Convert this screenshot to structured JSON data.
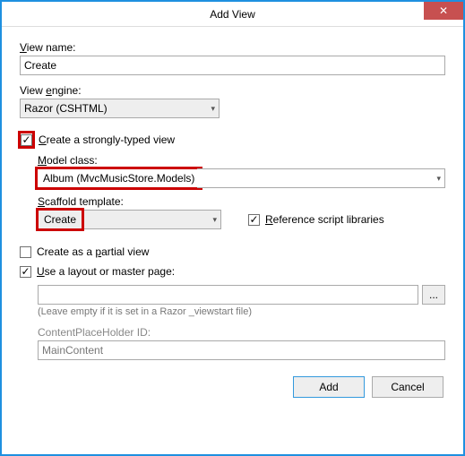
{
  "window": {
    "title": "Add View"
  },
  "viewName": {
    "label": "View name:",
    "value": "Create"
  },
  "viewEngine": {
    "label": "View engine:",
    "value": "Razor (CSHTML)"
  },
  "stronglyTyped": {
    "checked": true,
    "label": "Create a strongly-typed view"
  },
  "modelClass": {
    "label": "Model class:",
    "value": "Album (MvcMusicStore.Models)"
  },
  "scaffold": {
    "label": "Scaffold template:",
    "value": "Create"
  },
  "refScript": {
    "checked": true,
    "label": "Reference script libraries"
  },
  "partial": {
    "checked": false,
    "label": "Create as a partial view"
  },
  "useLayout": {
    "checked": true,
    "label": "Use a layout or master page:"
  },
  "layoutPath": {
    "value": "",
    "hint": "(Leave empty if it is set in a Razor _viewstart file)"
  },
  "placeholder": {
    "label": "ContentPlaceHolder ID:",
    "value": "MainContent"
  },
  "buttons": {
    "add": "Add",
    "cancel": "Cancel",
    "browse": "..."
  },
  "icons": {
    "check": "✓",
    "arrow": "▾",
    "close": "✕"
  }
}
